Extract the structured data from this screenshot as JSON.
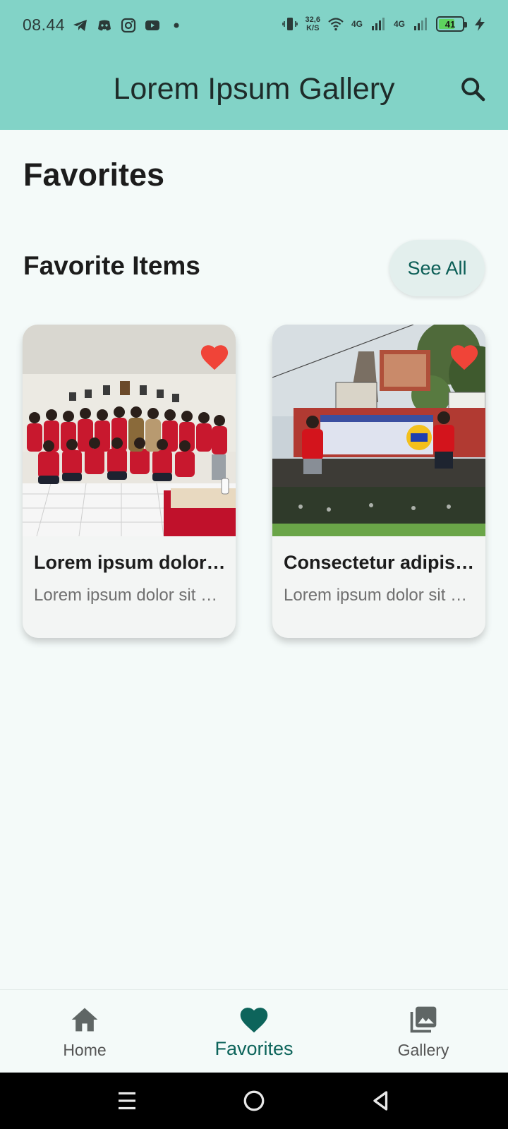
{
  "status_bar": {
    "time": "08.44",
    "speed_value": "32,6",
    "speed_unit": "K/S",
    "net1": "4G",
    "net2": "4G",
    "battery": "41",
    "left_icons": [
      "telegram-icon",
      "discord-icon",
      "instagram-icon",
      "youtube-icon",
      "dot-icon"
    ],
    "right_icons": [
      "vibrate-icon",
      "wifi-icon",
      "signal-icon",
      "signal-icon",
      "battery-icon",
      "charging-icon"
    ]
  },
  "app_bar": {
    "title": "Lorem Ipsum Gallery",
    "search_icon": "search-icon"
  },
  "page": {
    "title": "Favorites",
    "section_title": "Favorite Items",
    "see_all": "See All"
  },
  "cards": [
    {
      "title": "Lorem ipsum dolor sit amet",
      "subtitle": "Lorem ipsum dolor sit amet, consectetur",
      "favorite": true,
      "image": "group photo of students in red shirts in a classroom"
    },
    {
      "title": "Consectetur adipiscing elit",
      "subtitle": "Lorem ipsum dolor sit amet, consectetur",
      "favorite": true,
      "image": "two people standing beside a KKN banner outdoors"
    }
  ],
  "bottom_nav": {
    "items": [
      {
        "label": "Home",
        "icon": "home-icon",
        "active": false
      },
      {
        "label": "Favorites",
        "icon": "heart-icon",
        "active": true
      },
      {
        "label": "Gallery",
        "icon": "photo-library-icon",
        "active": false
      }
    ]
  },
  "system_nav": [
    "menu-icon",
    "home-circle-icon",
    "back-icon"
  ],
  "colors": {
    "app_bar": "#82d3c7",
    "background": "#f4faf9",
    "accent": "#0d645b",
    "favorite": "#f04438"
  }
}
